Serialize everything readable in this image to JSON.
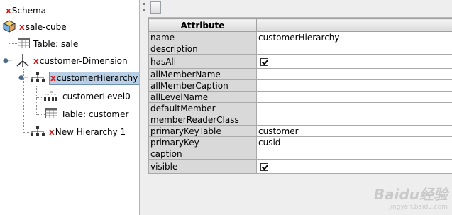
{
  "tree": {
    "schema": {
      "prefix": "x",
      "label": "Schema"
    },
    "cube": {
      "prefix": "x",
      "label": "sale-cube"
    },
    "table_sale": {
      "label": "Table: sale"
    },
    "dimension": {
      "prefix": "x",
      "label": "customer-Dimension"
    },
    "hierarchy": {
      "prefix": "x",
      "label": "customerHierarchy",
      "selected": true
    },
    "level": {
      "label": "customerLevel0"
    },
    "table_customer": {
      "label": "Table: customer"
    },
    "new_hierarchy": {
      "prefix": "x",
      "label": "New Hierarchy 1"
    }
  },
  "grid": {
    "header_attribute": "Attribute",
    "header_value": "",
    "rows": [
      {
        "name": "name",
        "value": "customerHierarchy",
        "type": "text"
      },
      {
        "name": "description",
        "value": "",
        "type": "text"
      },
      {
        "name": "hasAll",
        "value": true,
        "type": "checkbox"
      },
      {
        "name": "allMemberName",
        "value": "",
        "type": "text"
      },
      {
        "name": "allMemberCaption",
        "value": "",
        "type": "text"
      },
      {
        "name": "allLevelName",
        "value": "",
        "type": "text"
      },
      {
        "name": "defaultMember",
        "value": "",
        "type": "text"
      },
      {
        "name": "memberReaderClass",
        "value": "",
        "type": "text"
      },
      {
        "name": "primaryKeyTable",
        "value": "customer",
        "type": "text"
      },
      {
        "name": "primaryKey",
        "value": "cusid",
        "type": "text"
      },
      {
        "name": "caption",
        "value": "",
        "type": "text"
      },
      {
        "name": "visible",
        "value": true,
        "type": "checkbox"
      }
    ]
  },
  "watermark": {
    "brand": "Baidu经验",
    "url": "jingyan.baidu.com"
  }
}
